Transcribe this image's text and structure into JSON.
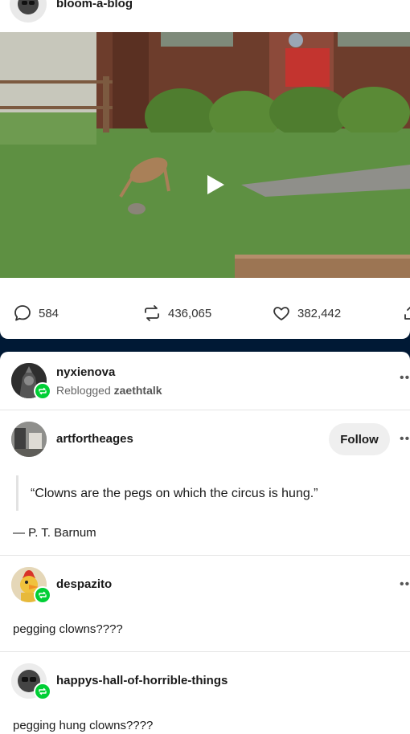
{
  "post1": {
    "blog_name": "bloom-a-blog",
    "counts": {
      "replies": "584",
      "reblogs": "436,065",
      "likes": "382,442"
    }
  },
  "reblog_header": {
    "user": "nyxienova",
    "prefix": "Reblogged",
    "from": "zaethtalk"
  },
  "thread": [
    {
      "user": "artfortheages",
      "follow_label": "Follow",
      "quote": "“Clowns are the pegs on which the circus is hung.”",
      "attribution": "— P. T. Barnum"
    },
    {
      "user": "despazito",
      "text": "pegging clowns????"
    },
    {
      "user": "happys-hall-of-horrible-things",
      "text": "pegging hung clowns????"
    }
  ],
  "colors": {
    "background": "#001935",
    "reblog_badge": "#00cf35"
  }
}
